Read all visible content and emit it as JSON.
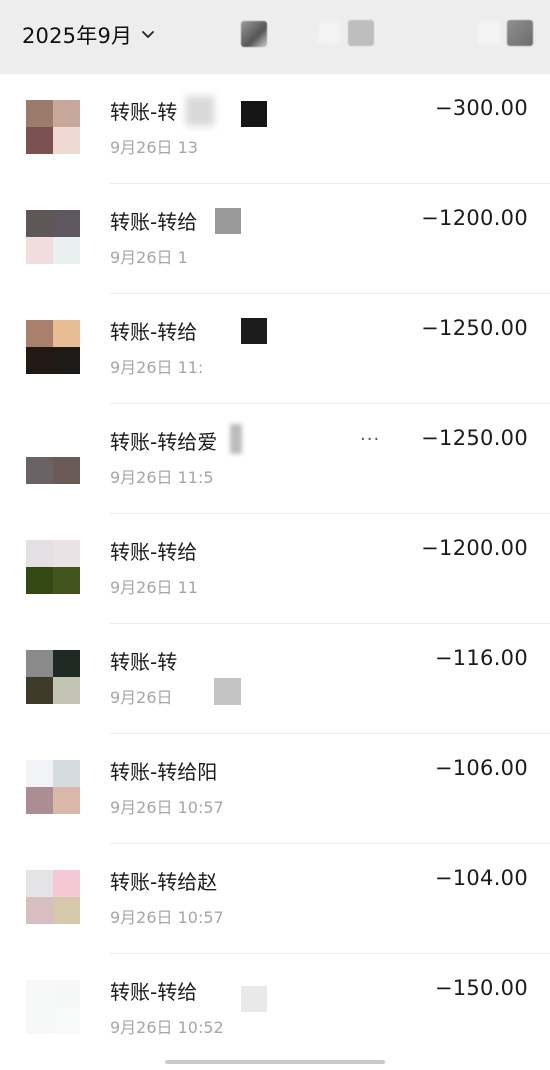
{
  "header": {
    "month_label": "2025年9月",
    "icons": [
      "blurred-icon-1",
      "blurred-icon-2",
      "blurred-icon-3"
    ]
  },
  "transactions": [
    {
      "title": "转账-转",
      "time": "9月26日 13",
      "amount": "−300.00",
      "avatar": [
        "#9c7b6b",
        "#c7a89a",
        "#7a5150",
        "#eedad3"
      ]
    },
    {
      "title": "转账-转给",
      "time": "9月26日 1",
      "amount": "−1200.00",
      "avatar": [
        "#5f5657",
        "#5c5760",
        "#f1dcde",
        "#e8f1ef"
      ]
    },
    {
      "title": "转账-转给",
      "time": "9月26日 11:",
      "amount": "−1250.00",
      "avatar": [
        "#a9806b",
        "#e9bd93",
        "#221814",
        "#1e1a17"
      ]
    },
    {
      "title": "转账-转给爱",
      "time": "9月26日 11:5",
      "amount": "−1250.00",
      "avatar": [
        "#ffffff",
        "#ffffff",
        "#6b6266",
        "#6a5b56"
      ]
    },
    {
      "title": "转账-转给",
      "time": "9月26日 11",
      "amount": "−1200.00",
      "avatar": [
        "#e4e0e3",
        "#ebe2e6",
        "#334812",
        "#42551d"
      ]
    },
    {
      "title": "转账-转",
      "time": "9月26日",
      "amount": "−116.00",
      "avatar": [
        "#8a8a8a",
        "#1f2a24",
        "#3d3a2a",
        "#c3c4b4"
      ]
    },
    {
      "title": "转账-转给阳",
      "time": "9月26日 10:57",
      "amount": "−106.00",
      "avatar": [
        "#f1f3f6",
        "#d6dbe2",
        "#ad8d94",
        "#d9b8aa"
      ]
    },
    {
      "title": "转账-转给赵",
      "time": "9月26日 10:57",
      "amount": "−104.00",
      "avatar": [
        "#e4e4e6",
        "#f6c8d6",
        "#d7bec1",
        "#d6c9ab"
      ]
    },
    {
      "title": "转账-转给",
      "time": "9月26日 10:52",
      "amount": "−150.00",
      "avatar": [
        "#f7f9f8",
        "#f6f8f7",
        "#f7f9f8",
        "#f8f9f9"
      ]
    }
  ],
  "row4_more": "···"
}
